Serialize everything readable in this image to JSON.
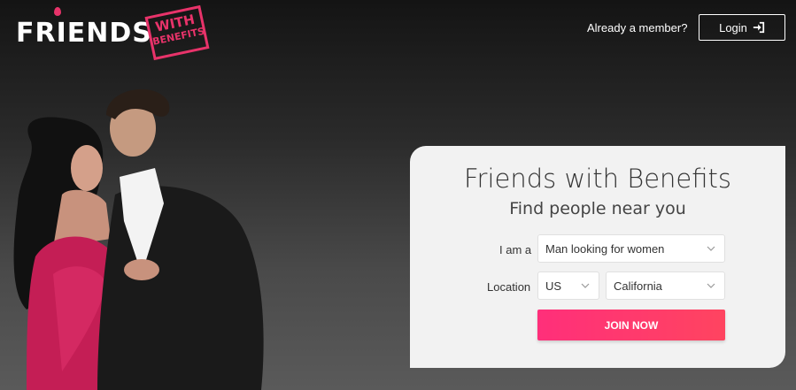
{
  "header": {
    "logo_text": "FRIENDS",
    "logo_stamp_line1": "WITH",
    "logo_stamp_line2": "BENEFITS",
    "member_prompt": "Already a member?",
    "login_label": "Login",
    "login_icon": "login-icon"
  },
  "hero": {
    "title": "Friends with Benefits",
    "subtitle": "Find people near you"
  },
  "form": {
    "iam_label": "I am a",
    "iam_value": "Man looking for women",
    "location_label": "Location",
    "country_value": "US",
    "region_value": "California",
    "join_label": "JOIN NOW"
  },
  "colors": {
    "accent": "#e8336a",
    "button_start": "#ff2f7a",
    "button_end": "#ff4460",
    "panel_bg": "#f2f2f2"
  }
}
